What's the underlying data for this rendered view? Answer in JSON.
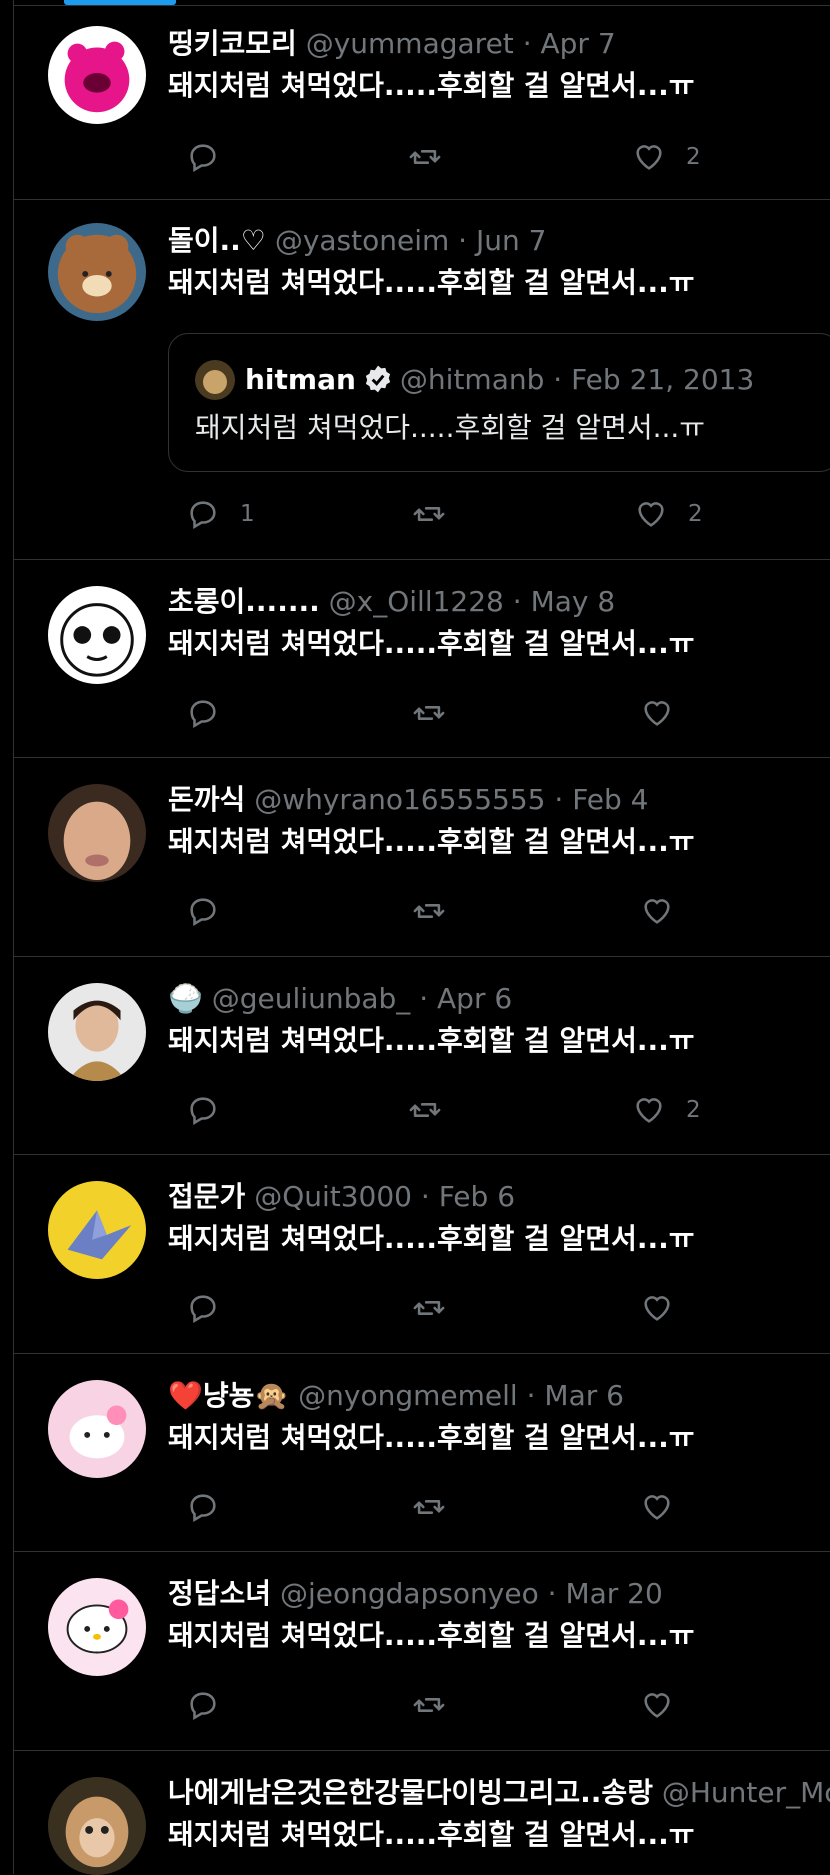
{
  "tweets": [
    {
      "name": "띵키코모리",
      "handle": "@yummagaret",
      "date": "Apr 7",
      "text": "돼지처럼 쳐먹었다.....후회할 걸 알면서...ㅠ",
      "reply_count": "",
      "retweet_count": "",
      "like_count": "2"
    },
    {
      "name": "돌이..♡",
      "handle": "@yastoneim",
      "date": "Jun 7",
      "text": "돼지처럼 쳐먹었다.....후회할 걸 알면서...ㅠ",
      "reply_count": "1",
      "retweet_count": "",
      "like_count": "2"
    },
    {
      "name": "초롱이.......",
      "handle": "@x_Oill1228",
      "date": "May 8",
      "text": "돼지처럼 쳐먹었다.....후회할 걸 알면서...ㅠ",
      "reply_count": "",
      "retweet_count": "",
      "like_count": ""
    },
    {
      "name": "돈까식",
      "handle": "@whyrano16555555",
      "date": "Feb 4",
      "text": "돼지처럼 쳐먹었다.....후회할 걸 알면서...ㅠ",
      "reply_count": "",
      "retweet_count": "",
      "like_count": ""
    },
    {
      "name": "🍚",
      "handle": "@geuliunbab_",
      "date": "Apr 6",
      "text": "돼지처럼 쳐먹었다.....후회할 걸 알면서...ㅠ",
      "reply_count": "",
      "retweet_count": "",
      "like_count": "2"
    },
    {
      "name": "접문가",
      "handle": "@Quit3000",
      "date": "Feb 6",
      "text": "돼지처럼 쳐먹었다.....후회할 걸 알면서...ㅠ",
      "reply_count": "",
      "retweet_count": "",
      "like_count": ""
    },
    {
      "name": "❤️냥뇽🙊",
      "handle": "@nyongmemell",
      "date": "Mar 6",
      "text": "돼지처럼 쳐먹었다.....후회할 걸 알면서...ㅠ",
      "reply_count": "",
      "retweet_count": "",
      "like_count": ""
    },
    {
      "name": "정답소녀",
      "handle": "@jeongdapsonyeo",
      "date": "Mar 20",
      "text": "돼지처럼 쳐먹었다.....후회할 걸 알면서...ㅠ",
      "reply_count": "",
      "retweet_count": "",
      "like_count": ""
    },
    {
      "name": "나에게남은것은한강물다이빙그리고..송랑",
      "handle": "@Hunter_Mc",
      "date": "",
      "text": "돼지처럼 쳐먹었다.....후회할 걸 알면서...ㅠ",
      "reply_count": "",
      "retweet_count": "",
      "like_count": ""
    }
  ],
  "quote": {
    "name": "hitman",
    "handle": "@hitmanb",
    "date": "Feb 21, 2013",
    "text": "돼지처럼 쳐먹었다.....후회할 걸 알면서...ㅠ"
  },
  "separator": "·",
  "icons": {
    "reply": "reply-icon",
    "retweet": "retweet-icon",
    "like": "heart-icon",
    "verified": "verified-badge-icon"
  },
  "colors": {
    "background": "#000000",
    "text": "#ffffff",
    "muted": "#71767b",
    "border": "#2f3336",
    "accent": "#1d9bf0"
  }
}
